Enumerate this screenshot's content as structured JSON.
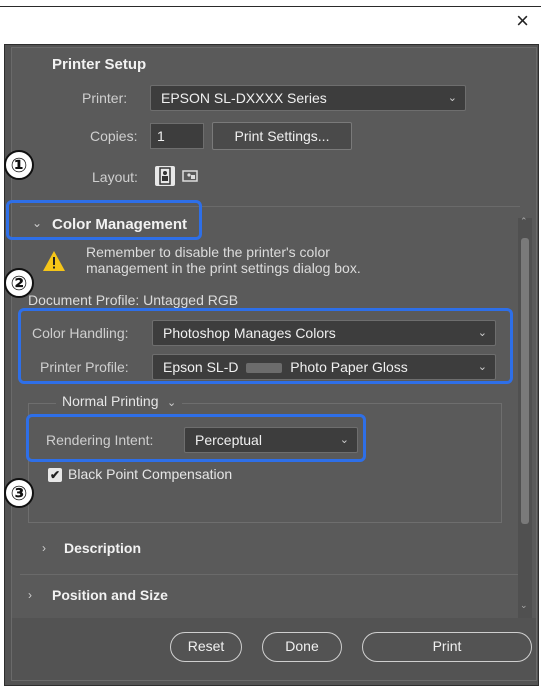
{
  "window": {
    "close_glyph": "×"
  },
  "printer_setup": {
    "title": "Printer Setup",
    "printer_label": "Printer:",
    "printer_value": "EPSON SL-DXXXX Series",
    "copies_label": "Copies:",
    "copies_value": "1",
    "print_settings_button": "Print Settings...",
    "layout_label": "Layout:"
  },
  "color_management": {
    "title": "Color Management",
    "warning_line1": "Remember to disable the printer's color",
    "warning_line2": "management in the print settings dialog box.",
    "document_profile": "Document Profile: Untagged RGB",
    "color_handling_label": "Color Handling:",
    "color_handling_value": "Photoshop Manages Colors",
    "printer_profile_label": "Printer Profile:",
    "printer_profile_value_a": "Epson SL-D",
    "printer_profile_value_b": "Photo Paper Gloss",
    "normal_printing": "Normal Printing",
    "rendering_intent_label": "Rendering Intent:",
    "rendering_intent_value": "Perceptual",
    "black_point": "Black Point Compensation"
  },
  "sections": {
    "description": "Description",
    "position_and_size": "Position and Size"
  },
  "footer": {
    "reset": "Reset",
    "done": "Done",
    "print": "Print"
  },
  "callouts": {
    "one": "①",
    "two": "②",
    "three": "③"
  },
  "colors": {
    "highlight": "#2e6fe8",
    "dialog_bg": "#535353",
    "warning": "#f5c518"
  },
  "icons": [
    "close-icon",
    "chevron-down-icon",
    "chevron-right-icon",
    "portrait-icon",
    "landscape-icon",
    "warning-icon",
    "check-icon"
  ]
}
